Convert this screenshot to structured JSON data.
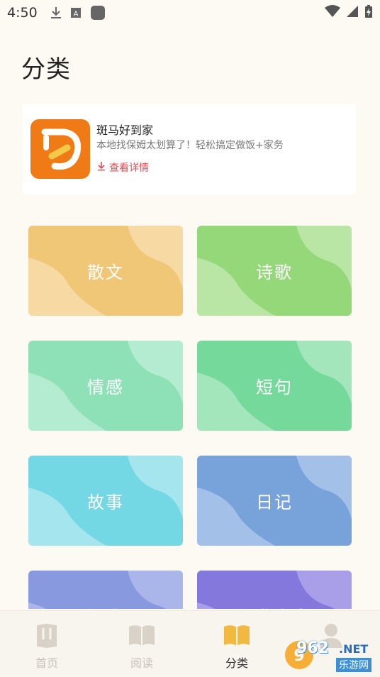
{
  "status_bar": {
    "time": "4:50",
    "icons": [
      "download-icon",
      "font-app-icon",
      "app-square-icon",
      "wifi-icon",
      "signal-icon",
      "battery-charging-icon"
    ]
  },
  "page": {
    "title": "分类"
  },
  "ad": {
    "name": "斑马好到家",
    "description": "本地找保姆太划算了！轻松搞定做饭+家务",
    "detail_label": "查看详情",
    "logo_color": "#f07b16"
  },
  "categories": [
    {
      "label": "散文",
      "base": "#f0c677",
      "light": "#f6d9a3"
    },
    {
      "label": "诗歌",
      "base": "#94d87a",
      "light": "#b9e6a4"
    },
    {
      "label": "情感",
      "base": "#8ee0b6",
      "light": "#b4ecd1"
    },
    {
      "label": "短句",
      "base": "#74d99a",
      "light": "#a3e6bb"
    },
    {
      "label": "故事",
      "base": "#74d7e4",
      "light": "#a5e6ee"
    },
    {
      "label": "日记",
      "base": "#78a3da",
      "light": "#a3c1e8"
    },
    {
      "label": "短文",
      "base": "#8899e0",
      "light": "#aab6ea"
    },
    {
      "label": "经典文章",
      "base": "#8478dc",
      "light": "#a89fe8"
    }
  ],
  "bottom_nav": {
    "items": [
      {
        "label": "首页",
        "icon": "home-book-icon",
        "active": false
      },
      {
        "label": "阅读",
        "icon": "open-book-icon",
        "active": false
      },
      {
        "label": "分类",
        "icon": "category-book-icon",
        "active": true
      },
      {
        "label": "",
        "icon": "profile-icon",
        "active": false
      }
    ]
  },
  "watermark": {
    "brand": "962",
    "suffix": ".NET",
    "site": "乐游网"
  },
  "colors": {
    "background": "#fdfaf4",
    "active_nav": "#f2b940",
    "inactive_nav": "#d8d2c8",
    "accent_red": "#e5484d"
  }
}
